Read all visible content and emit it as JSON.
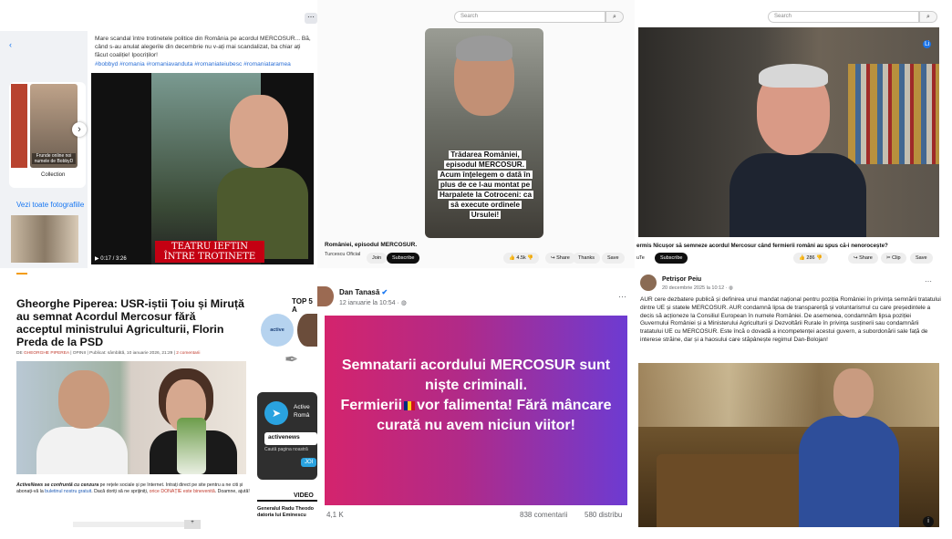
{
  "panel1": {
    "post_text": "Mare scandal între trotinetele politice din România pe acordul MERCOSUR... Bă, când s-au anulat alegerile din decembrie nu v-ați mai scandalizat, ba chiar ați făcut coaliție! Ipocriților!",
    "hashtags": "#bobbyd #romania #romaniavanduta #romaniateiubesc #romaniataramea",
    "thumb_caption": "Frunde online noi numele de BobbyD",
    "collection_label": "Collection",
    "see_all_photos": "Vezi toate fotografiile",
    "video_overlay": "TEATRU IEFTIN ÎNTRE TROTINETE",
    "video_time": "0:17 / 3:26",
    "more_icon": "ellipsis-icon",
    "accent": "#1877f2"
  },
  "panel2": {
    "search_placeholder": "Search",
    "caption": "Trădarea României, episodul MERCOSUR. Acum înțelegem o dată în plus de ce l-au montat pe Harpalete la Cotroceni: ca să execute ordinele Ursulei!",
    "video_title": "României, episodul MERCOSUR.",
    "channel": "Turcescu Oficial",
    "join_label": "Join",
    "subscribe_label": "Subscribe",
    "likes": "4.5k",
    "share_label": "Share",
    "thanks_label": "Thanks",
    "save_label": "Save"
  },
  "panel3": {
    "search_placeholder": "Search",
    "video_title": "ermis Nicușor să semneze acordul Mercosur când fermierii români au spus că-i nenorocește?",
    "badge": "Li",
    "channel_fragment": "uTe",
    "subscribe_label": "Subscribe",
    "likes": "286",
    "share_label": "Share",
    "clip_label": "Clip",
    "save_label": "Save"
  },
  "panel4": {
    "headline": "Gheorghe Piperea: USR-iștii Țoiu și Miruță au semnat Acordul Mercosur fără acceptul ministrului Agriculturii, Florin Preda de la PSD",
    "meta_author": "GHEORGHE PIPEREA",
    "meta_prefix": "DE",
    "meta_category": "OPINII",
    "meta_date": "Publicat: sâmbătă, 10 ianuarie 2026, 21:29",
    "meta_comments": "2 comentarii",
    "disclaimer_bold": "ActiveNews se confruntă cu cenzura",
    "disclaimer_text": " pe rețele sociale și pe Internet. Intrați direct pe site pentru a ne citi și abonați-vă la ",
    "disclaimer_link": "buletinul nostru gratuit",
    "disclaimer_mid": ". Dacă doriți să ne sprijiniți, ",
    "disclaimer_red": "orice DONAȚIE este binevenită",
    "disclaimer_end": ". Doamne, ajută!",
    "top5": "TOP 5 A",
    "logo_text": "active",
    "telegram_name": "Active Româ",
    "telegram_handle": "activenews",
    "telegram_search": "Caută pagina noastră",
    "telegram_join": "JOI",
    "video_section": "VIDEO",
    "video_caption": "Generalul Radu Theodo datoria lui Eminescu"
  },
  "panel5": {
    "author": "Dan Tanasă",
    "date": "12 ianuarie la 10:54 · ",
    "banner_line1": "Semnatarii acordului MERCOSUR sunt niște criminali.",
    "banner_line2a": "Fermierii",
    "banner_line2b": "vor falimenta! Fără mâncare curată nu avem niciun viitor!",
    "reactions": "4,1 K",
    "comments": "838 comentarii",
    "shares": "580 distribu"
  },
  "panel6": {
    "author": "Petrișor Peiu",
    "date": "20 decembrie 2025 la 10:12 · ",
    "text": "AUR cere dezbatere publică și definirea unui mandat național pentru poziția României în privința semnării tratatului dintre UE și statele MERCOSUR. AUR condamnă lipsa de transparență și voluntarismul cu care președintele a decis să acționeze la Consiliul European în numele României. De asemenea, condamnăm lipsa poziției Guvernului României și a Ministerului Agriculturii și Dezvoltării Rurale în privința susținerii sau condamnării tratatului UE cu MERCOSUR. Este încă o dovadă a incompetenței acestui guvern, a subordonării sale față de interese străine, dar și a haosului care stăpânește regimul Dan-Bolojan!",
    "info_icon": "i"
  }
}
